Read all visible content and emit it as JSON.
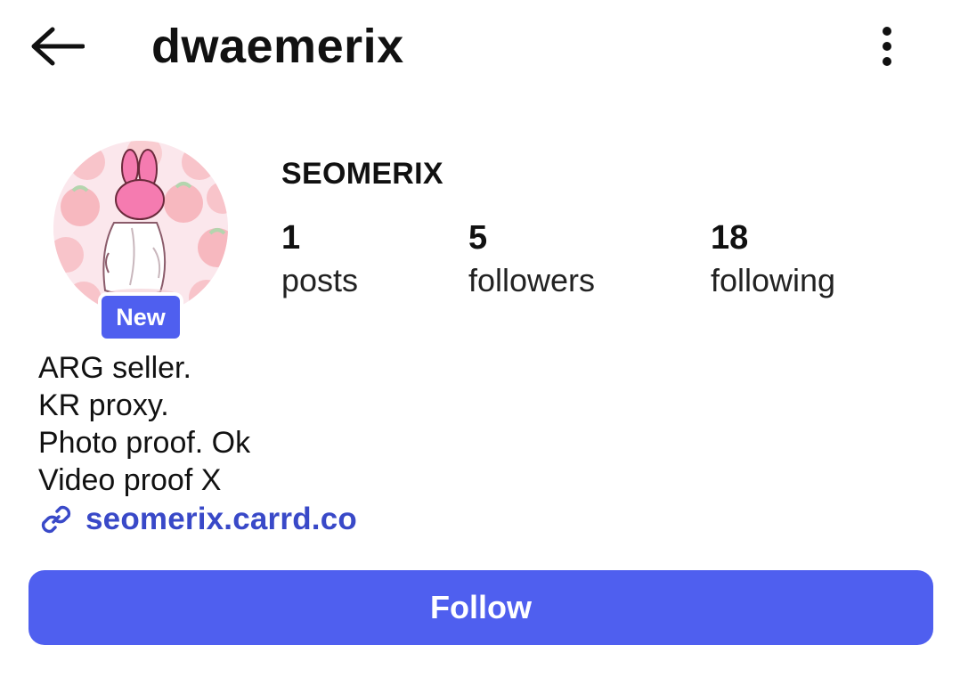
{
  "header": {
    "username": "dwaemerix",
    "back_icon": "arrow-left-icon",
    "more_icon": "more-vertical-icon"
  },
  "profile": {
    "display_name": "SEOMERIX",
    "badge": "New",
    "avatar_description_icon": "avatar-bunny-image"
  },
  "stats": {
    "posts": {
      "count": "1",
      "label": "posts"
    },
    "followers": {
      "count": "5",
      "label": "followers"
    },
    "following": {
      "count": "18",
      "label": "following"
    }
  },
  "bio": {
    "lines": [
      "ARG seller.",
      "KR proxy.",
      "Photo proof. Ok",
      "Video proof X"
    ],
    "link": "seomerix.carrd.co",
    "link_icon": "link-icon"
  },
  "actions": {
    "follow_label": "Follow"
  },
  "colors": {
    "accent": "#4f5fef",
    "link": "#3949c8",
    "text": "#111111"
  }
}
